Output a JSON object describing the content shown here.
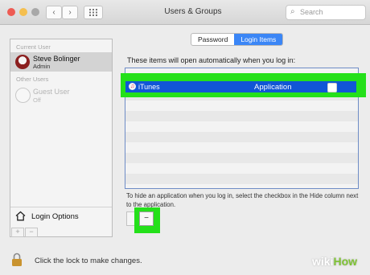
{
  "colors": {
    "accent": "#3b86f6",
    "selection": "#1156d6",
    "highlight": "#24e01a",
    "close": "#ee5b53",
    "minimize": "#f5bf4f",
    "zoom": "#a8a8a8"
  },
  "window": {
    "title": "Users & Groups",
    "back_icon": "chevron-left-icon",
    "forward_icon": "chevron-right-icon",
    "grid_icon": "grid-icon",
    "search": {
      "placeholder": "Search",
      "icon": "search-icon"
    }
  },
  "sidebar": {
    "current_user_heading": "Current User",
    "current_user": {
      "name": "Steve Bolinger",
      "role": "Admin"
    },
    "other_users_heading": "Other Users",
    "guest_user": {
      "name": "Guest User",
      "state": "Off"
    },
    "login_options_label": "Login Options",
    "add_label": "+",
    "remove_label": "−"
  },
  "tabs": [
    {
      "label": "Password",
      "active": false
    },
    {
      "label": "Login Items",
      "active": true
    }
  ],
  "login_items": {
    "caption": "These items will open automatically when you log in:",
    "items": [
      {
        "name": "iTunes",
        "kind": "Application",
        "hide": false,
        "selected": true
      }
    ],
    "hint": "To hide an application when you log in, select the checkbox in the Hide column next to the application.",
    "remove_label": "−"
  },
  "footer": {
    "lock_text": "Click the lock to make changes.",
    "lock_icon": "lock-icon"
  },
  "watermark": {
    "part1": "wiki",
    "part2": "How"
  }
}
